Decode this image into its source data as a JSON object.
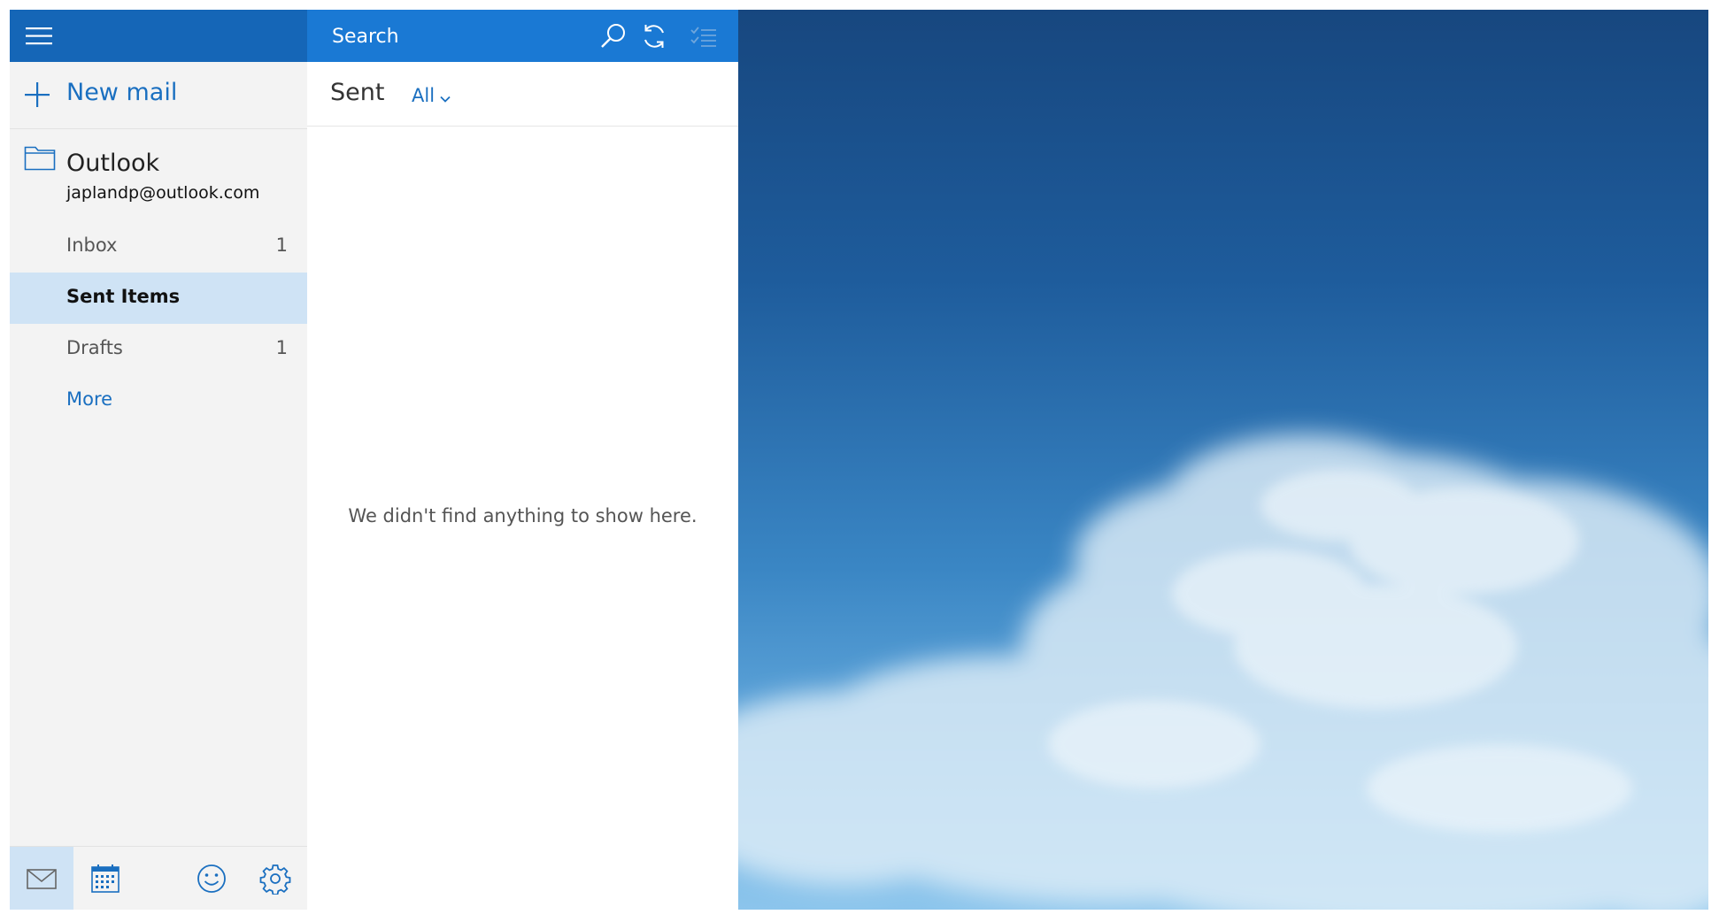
{
  "search": {
    "placeholder": "Search"
  },
  "nav": {
    "new_mail_label": "New mail",
    "account": {
      "name": "Outlook",
      "email": "japlandp@outlook.com"
    },
    "folders": [
      {
        "label": "Inbox",
        "count": "1",
        "selected": false
      },
      {
        "label": "Sent Items",
        "count": "",
        "selected": true
      },
      {
        "label": "Drafts",
        "count": "1",
        "selected": false
      },
      {
        "label": "More",
        "count": "",
        "selected": false
      }
    ],
    "footer_icons": [
      "mail-icon",
      "calendar-icon",
      "smiley-icon",
      "gear-icon"
    ]
  },
  "list": {
    "title": "Sent",
    "filter_label": "All",
    "empty_message": "We didn't find anything to show here."
  },
  "colors": {
    "nav_header": "#1566b7",
    "search_bar": "#1a79d4",
    "accent": "#1a6fc0",
    "selected_bg": "#cfe3f5",
    "nav_bg": "#f3f3f3"
  }
}
